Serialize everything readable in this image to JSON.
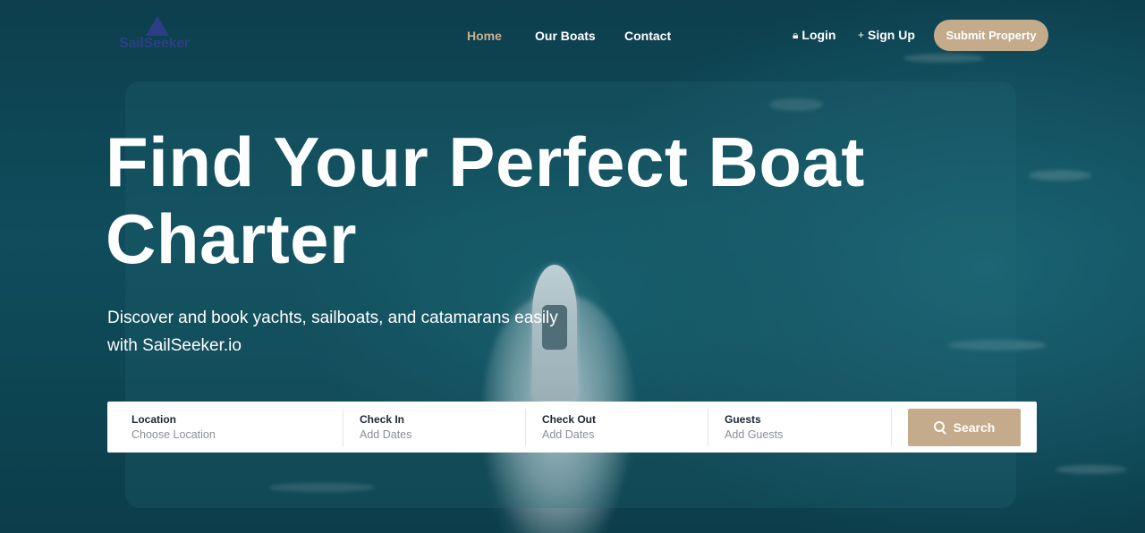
{
  "brand": {
    "logo_text": "SailSeeker",
    "logo_color": "#2c3f86"
  },
  "nav": {
    "items": [
      {
        "label": "Home",
        "active": true
      },
      {
        "label": "Our Boats",
        "active": false
      },
      {
        "label": "Contact",
        "active": false
      }
    ],
    "active_color": "#c9b08d"
  },
  "auth": {
    "login_label": "Login",
    "login_icon": "lock-icon",
    "signup_label": "Sign Up",
    "signup_icon": "plus-icon"
  },
  "header": {
    "submit_label": "Submit Property"
  },
  "hero": {
    "title_line1": "Find Your Perfect Boat",
    "title_line2": "Charter",
    "subtitle_line1": "Discover and book yachts, sailboats, and catamarans easily",
    "subtitle_line2": "with SailSeeker.io"
  },
  "search": {
    "fields": [
      {
        "label": "Location",
        "placeholder": "Choose Location"
      },
      {
        "label": "Check In",
        "placeholder": "Add Dates"
      },
      {
        "label": "Check Out",
        "placeholder": "Add Dates"
      },
      {
        "label": "Guests",
        "placeholder": "Add Guests"
      }
    ],
    "button_label": "Search",
    "button_icon": "search-icon",
    "accent_color": "#c4ab8c"
  }
}
